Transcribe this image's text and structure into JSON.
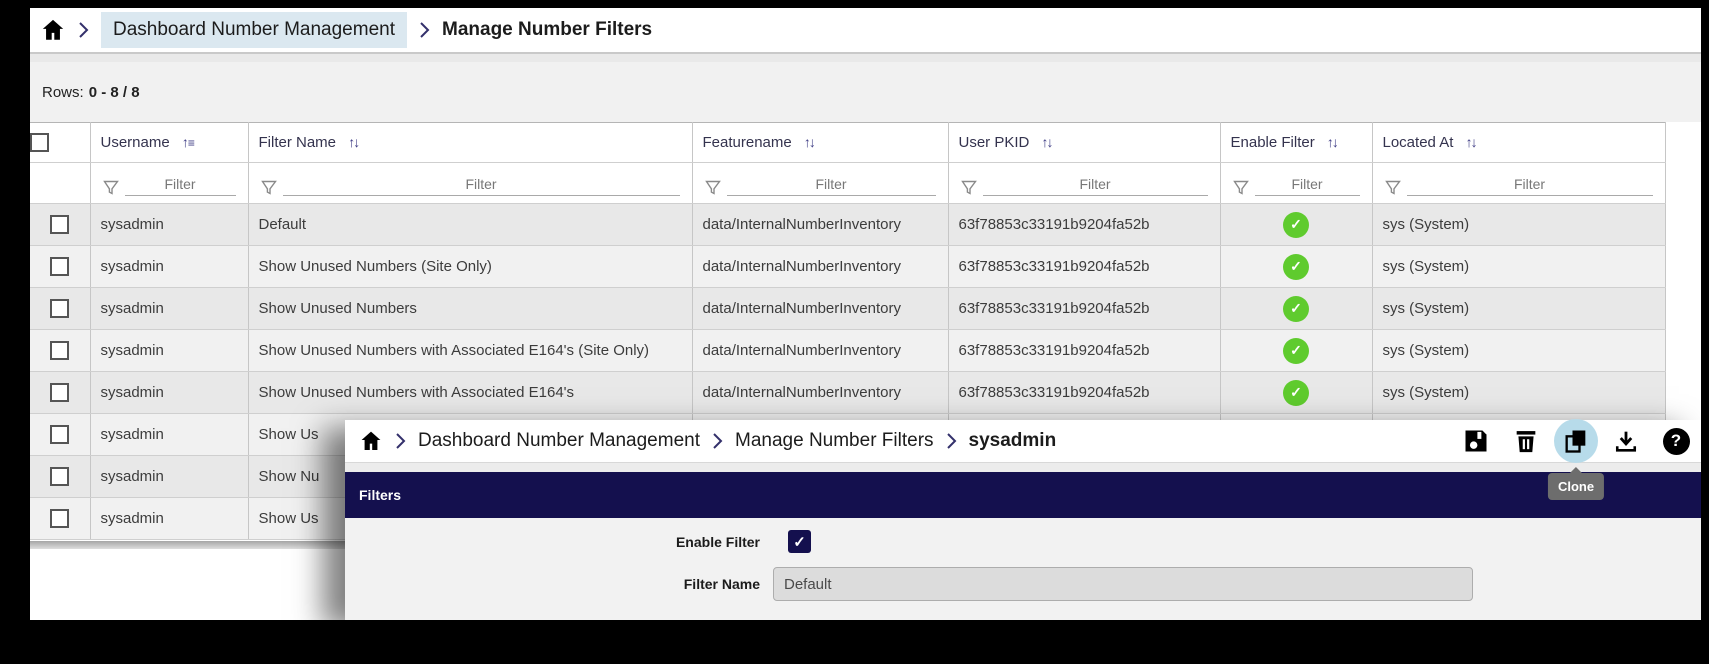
{
  "colors": {
    "accent_navy": "#14104e",
    "breadcrumb_highlight": "#dbe8f0",
    "enabled_green": "#5fcb2e",
    "clone_highlight_blue": "#b7dbea",
    "sorted_column_bg": "#d8d7e3"
  },
  "main_window": {
    "breadcrumb": {
      "items": [
        {
          "label": "Dashboard Number Management"
        },
        {
          "label": "Manage Number Filters"
        }
      ]
    },
    "rows_counter": {
      "label": "Rows:",
      "value": "0 - 8 / 8"
    },
    "table": {
      "columns": [
        {
          "label": "Username",
          "sort": "asc"
        },
        {
          "label": "Filter Name",
          "sort": "both"
        },
        {
          "label": "Featurename",
          "sort": "both"
        },
        {
          "label": "User PKID",
          "sort": "both"
        },
        {
          "label": "Enable Filter",
          "sort": "both"
        },
        {
          "label": "Located At",
          "sort": "both"
        }
      ],
      "filter_placeholder": "Filter",
      "rows": [
        {
          "username": "sysadmin",
          "filter_name": "Default",
          "featurename": "data/InternalNumberInventory",
          "user_pkid": "63f78853c33191b9204fa52b",
          "enable_filter": true,
          "located_at": "sys (System)"
        },
        {
          "username": "sysadmin",
          "filter_name": "Show Unused Numbers (Site Only)",
          "featurename": "data/InternalNumberInventory",
          "user_pkid": "63f78853c33191b9204fa52b",
          "enable_filter": true,
          "located_at": "sys (System)"
        },
        {
          "username": "sysadmin",
          "filter_name": "Show Unused Numbers",
          "featurename": "data/InternalNumberInventory",
          "user_pkid": "63f78853c33191b9204fa52b",
          "enable_filter": true,
          "located_at": "sys (System)"
        },
        {
          "username": "sysadmin",
          "filter_name": "Show Unused Numbers with Associated E164's (Site Only)",
          "featurename": "data/InternalNumberInventory",
          "user_pkid": "63f78853c33191b9204fa52b",
          "enable_filter": true,
          "located_at": "sys (System)"
        },
        {
          "username": "sysadmin",
          "filter_name": "Show Unused Numbers with Associated E164's",
          "featurename": "data/InternalNumberInventory",
          "user_pkid": "63f78853c33191b9204fa52b",
          "enable_filter": true,
          "located_at": "sys (System)"
        },
        {
          "username": "sysadmin",
          "filter_name": "Show Us",
          "featurename": "",
          "user_pkid": "",
          "enable_filter": false,
          "located_at": ""
        },
        {
          "username": "sysadmin",
          "filter_name": "Show Nu",
          "featurename": "",
          "user_pkid": "",
          "enable_filter": false,
          "located_at": ""
        },
        {
          "username": "sysadmin",
          "filter_name": "Show Us",
          "featurename": "",
          "user_pkid": "",
          "enable_filter": false,
          "located_at": ""
        }
      ]
    }
  },
  "detail_panel": {
    "breadcrumb": {
      "items": [
        {
          "label": "Dashboard Number Management"
        },
        {
          "label": "Manage Number Filters"
        },
        {
          "label": "sysadmin"
        }
      ]
    },
    "toolbar": {
      "icons": [
        "save",
        "delete",
        "clone",
        "download",
        "help"
      ],
      "active_icon": "clone",
      "help_glyph": "?"
    },
    "tooltip": "Clone",
    "section_header": "Filters",
    "form": {
      "enable_filter": {
        "label": "Enable Filter",
        "checked": true,
        "check_glyph": "✓"
      },
      "filter_name": {
        "label": "Filter Name",
        "value": "Default"
      }
    }
  },
  "glyphs": {
    "enabled_check": "✓",
    "sort_both": "↑↓",
    "sort_asc_arrow": "↑",
    "sort_asc_bars": "≡"
  }
}
